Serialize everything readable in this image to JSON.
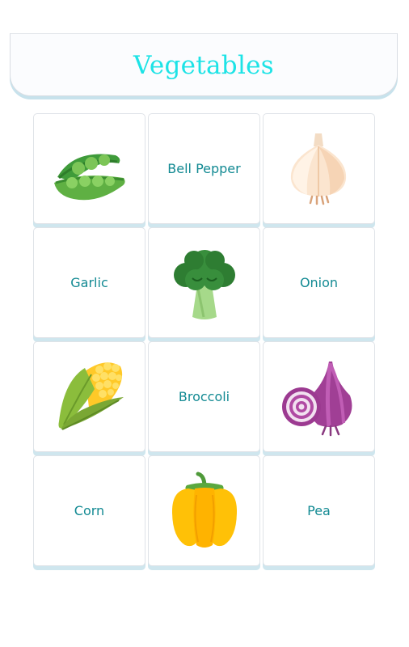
{
  "header": {
    "title": "Vegetables"
  },
  "cards": [
    {
      "type": "image",
      "icon": "pea-pod-icon"
    },
    {
      "type": "text",
      "label": "Bell Pepper"
    },
    {
      "type": "image",
      "icon": "garlic-icon"
    },
    {
      "type": "text",
      "label": "Garlic"
    },
    {
      "type": "image",
      "icon": "broccoli-icon"
    },
    {
      "type": "text",
      "label": "Onion"
    },
    {
      "type": "image",
      "icon": "corn-icon"
    },
    {
      "type": "text",
      "label": "Broccoli"
    },
    {
      "type": "image",
      "icon": "onion-icon"
    },
    {
      "type": "text",
      "label": "Corn"
    },
    {
      "type": "image",
      "icon": "bell-pepper-icon"
    },
    {
      "type": "text",
      "label": "Pea"
    }
  ],
  "colors": {
    "title": "#1de3e6",
    "label": "#138a93",
    "card_shadow": "#cfe6ee"
  }
}
